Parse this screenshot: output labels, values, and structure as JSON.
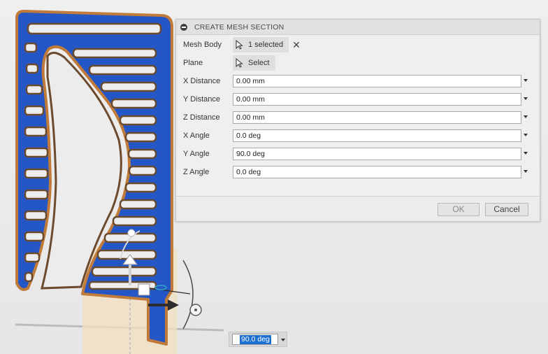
{
  "dialog": {
    "title": "CREATE MESH SECTION",
    "mesh_body": {
      "label": "Mesh Body",
      "value": "1 selected"
    },
    "plane": {
      "label": "Plane",
      "value": "Select"
    },
    "fields": [
      {
        "label": "X Distance",
        "value": "0.00 mm"
      },
      {
        "label": "Y Distance",
        "value": "0.00 mm"
      },
      {
        "label": "Z Distance",
        "value": "0.00 mm"
      },
      {
        "label": "X Angle",
        "value": "0.0 deg"
      },
      {
        "label": "Y Angle",
        "value": "90.0 deg"
      },
      {
        "label": "Z Angle",
        "value": "0.0 deg"
      }
    ],
    "ok_label": "OK",
    "cancel_label": "Cancel",
    "clear_icon": "x-icon",
    "collapse_icon": "minus-circle-icon",
    "cursor_icon": "pointer-arrow-icon"
  },
  "floating_input": {
    "value": "90.0 deg"
  },
  "colors": {
    "mesh_blue": "#2457c5",
    "mesh_edge": "#c07a3a",
    "plane_fill": "#f3dfc0",
    "selection_highlight": "#1a6fd1"
  }
}
